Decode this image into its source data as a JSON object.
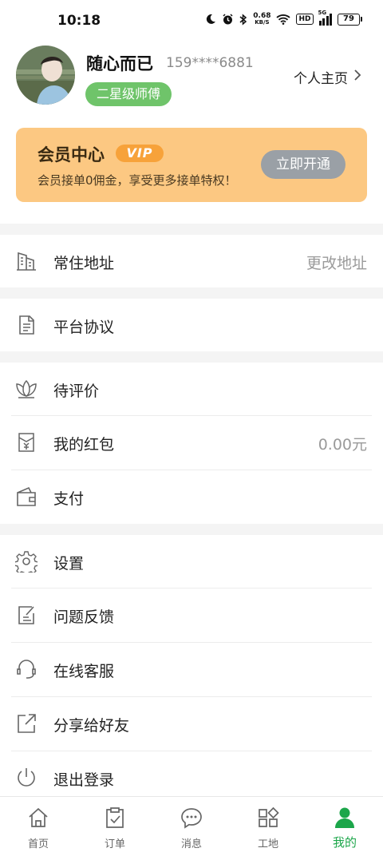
{
  "status_bar": {
    "time": "10:18",
    "net_speed_value": "0.68",
    "net_speed_unit": "KB/S",
    "hd": "HD",
    "signal": "5G",
    "battery": "79"
  },
  "profile": {
    "username": "随心而已",
    "phone": "159****6881",
    "level": "二星级师傅",
    "homepage_link": "个人主页"
  },
  "vip": {
    "title": "会员中心",
    "badge": "VIP",
    "subtitle": "会员接单0佣金，享受更多接单特权！",
    "button": "立即开通"
  },
  "menu": {
    "address": {
      "label": "常住地址",
      "value": "更改地址",
      "icon": "building-icon"
    },
    "agreement": {
      "label": "平台协议",
      "icon": "document-icon"
    },
    "review": {
      "label": "待评价",
      "icon": "lotus-icon"
    },
    "red_packet": {
      "label": "我的红包",
      "value": "0.00元",
      "icon": "red-packet-icon"
    },
    "payment": {
      "label": "支付",
      "icon": "wallet-icon"
    },
    "settings": {
      "label": "设置",
      "icon": "gear-icon"
    },
    "feedback": {
      "label": "问题反馈",
      "icon": "feedback-icon"
    },
    "support": {
      "label": "在线客服",
      "icon": "headset-icon"
    },
    "share": {
      "label": "分享给好友",
      "icon": "share-icon"
    },
    "logout": {
      "label": "退出登录",
      "icon": "power-icon"
    }
  },
  "tabs": [
    {
      "label": "首页",
      "icon": "home-icon"
    },
    {
      "label": "订单",
      "icon": "clipboard-icon"
    },
    {
      "label": "消息",
      "icon": "chat-icon"
    },
    {
      "label": "工地",
      "icon": "apps-icon"
    },
    {
      "label": "我的",
      "icon": "person-icon",
      "active": true
    }
  ],
  "colors": {
    "accent_green": "#1ca64a",
    "badge_green": "#6fc46a",
    "vip_card": "#fcc882",
    "vip_badge": "#f7a23a",
    "vip_button": "#9aa0a6"
  }
}
